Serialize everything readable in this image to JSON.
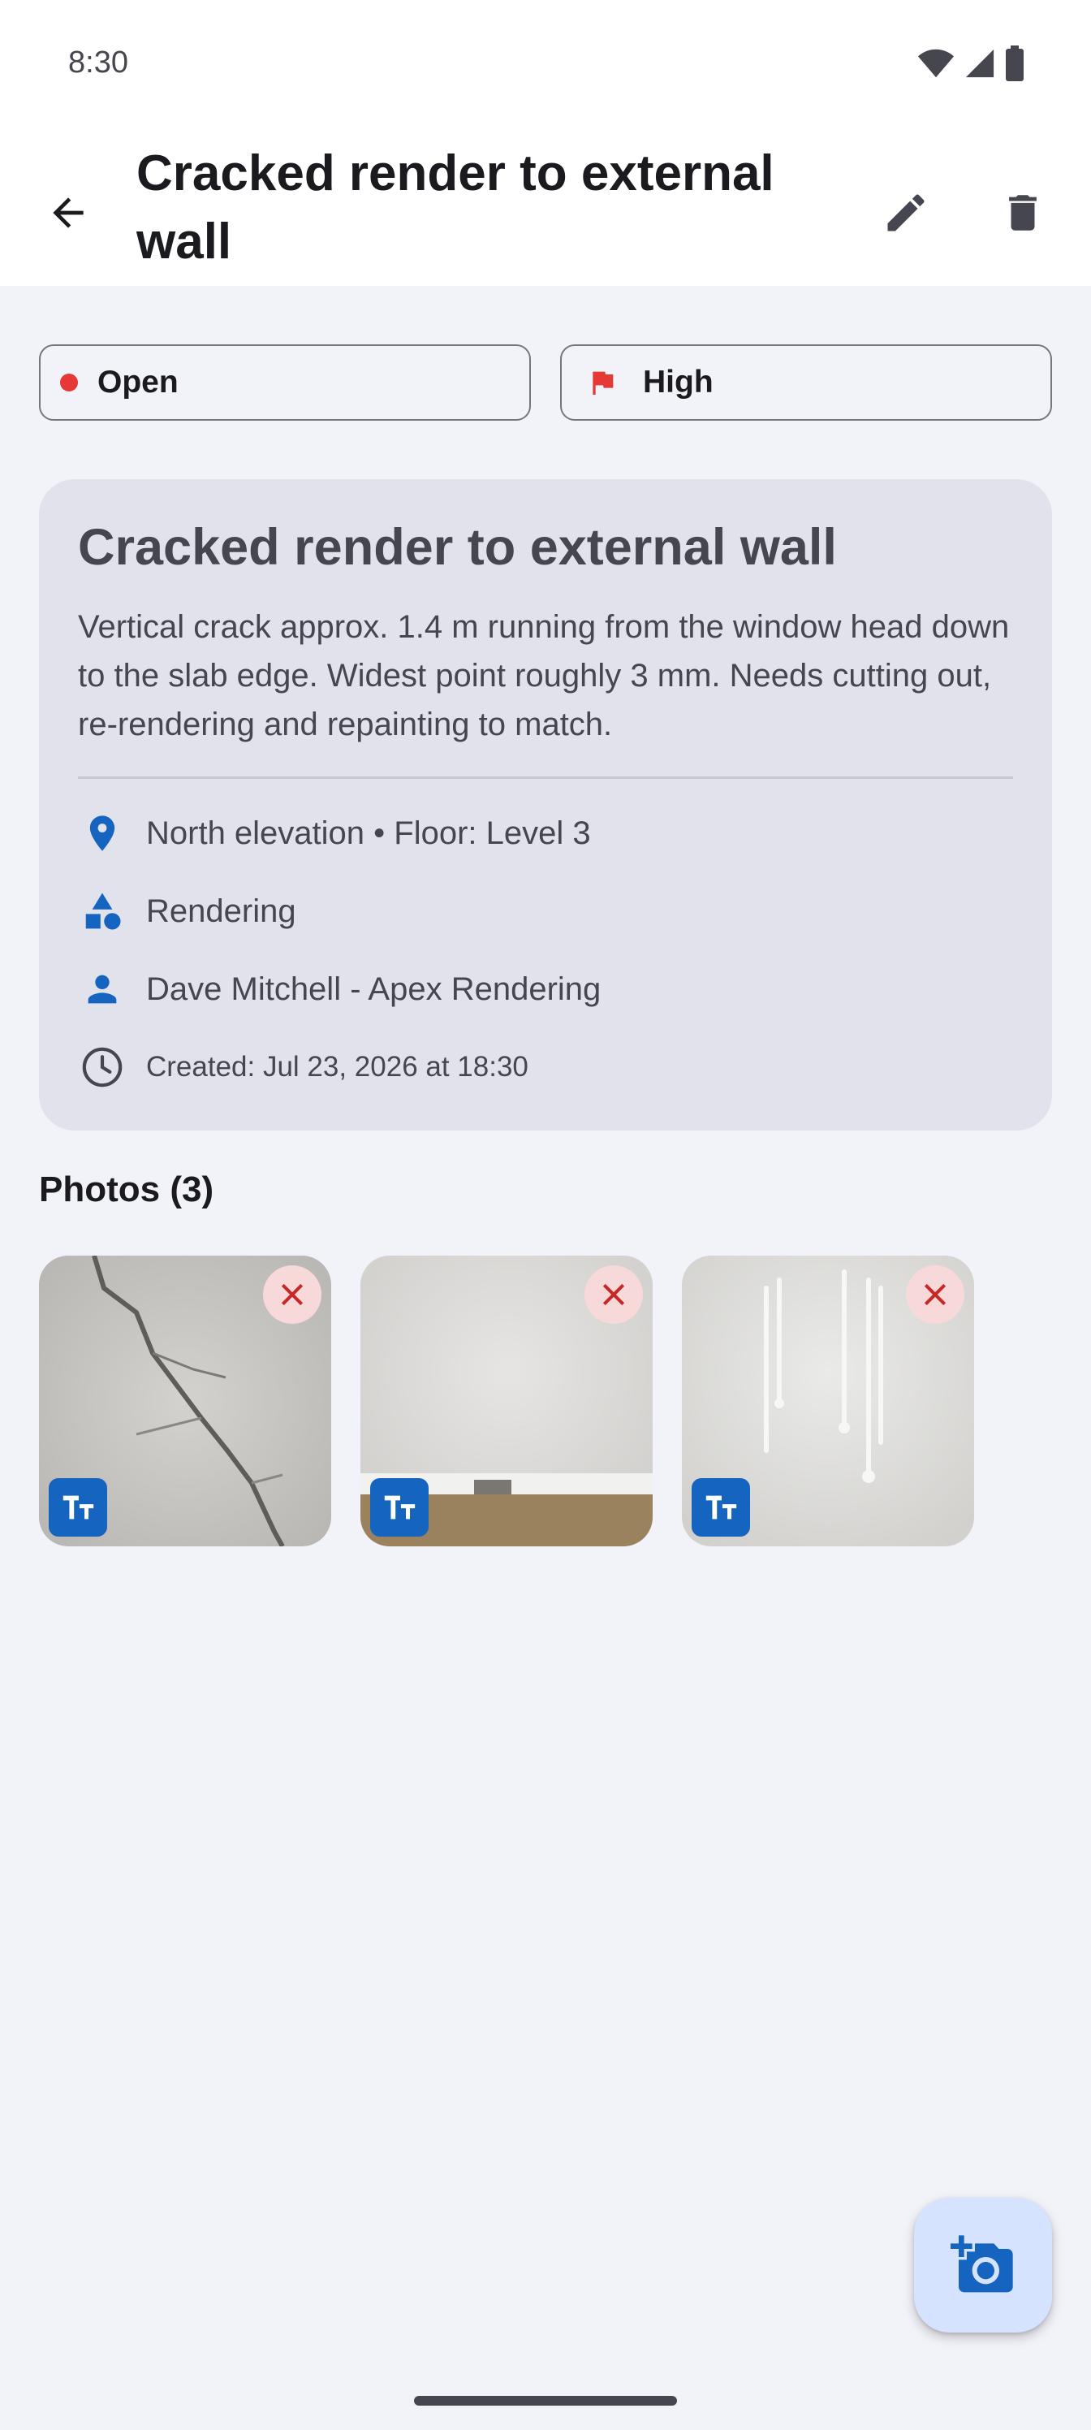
{
  "status_bar": {
    "time": "8:30"
  },
  "app_bar": {
    "title": "Cracked render to external wall"
  },
  "chips": {
    "status_label": "Open",
    "status_color": "#e53935",
    "priority_label": "High",
    "priority_color": "#e53935"
  },
  "issue": {
    "title": "Cracked render to external wall",
    "description": "Vertical crack approx. 1.4 m running from the window head down to the slab edge. Widest point roughly 3 mm. Needs cutting out, re-rendering and repainting to match.",
    "location": "North elevation • Floor: Level 3",
    "trade": "Rendering",
    "assignee": "Dave Mitchell - Apex Rendering",
    "created": "Created: Jul 23, 2026 at 18:30"
  },
  "photos": {
    "heading": "Photos (3)",
    "items": [
      {
        "subject": "crack-closeup",
        "remove_icon": "close-icon",
        "badge_icon": "text-annotation-icon"
      },
      {
        "subject": "slab-edge-vent",
        "remove_icon": "close-icon",
        "badge_icon": "text-annotation-icon"
      },
      {
        "subject": "drip-stains",
        "remove_icon": "close-icon",
        "badge_icon": "text-annotation-icon"
      }
    ]
  },
  "fab": {
    "icon": "add-photo-icon"
  },
  "colors": {
    "accent": "#1565c0",
    "surface": "#f2f2f9",
    "card": "#e2e2ec",
    "fab": "#d6e3ff",
    "remove": "#c62828"
  }
}
